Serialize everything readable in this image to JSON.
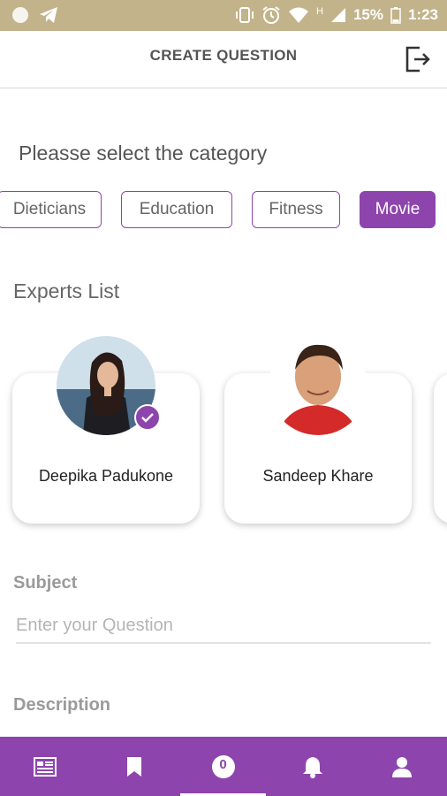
{
  "status_bar": {
    "battery_percent": "15%",
    "time": "1:23",
    "network_letter": "H"
  },
  "header": {
    "title": "CREATE QUESTION",
    "logout_icon": "logout-icon"
  },
  "prompt": "Pleasse select the category",
  "categories": [
    {
      "label": "Dieticians",
      "selected": false
    },
    {
      "label": "Education",
      "selected": false
    },
    {
      "label": "Fitness",
      "selected": false
    },
    {
      "label": "Movie",
      "selected": true
    }
  ],
  "experts": {
    "title": "Experts List",
    "items": [
      {
        "name": "Deepika Padukone",
        "selected": true
      },
      {
        "name": "Sandeep Khare",
        "selected": false
      }
    ]
  },
  "subject": {
    "label": "Subject",
    "placeholder": "Enter your Question",
    "value": ""
  },
  "description": {
    "label": "Description"
  },
  "bottom_nav": [
    {
      "icon": "feed-icon",
      "active": false
    },
    {
      "icon": "bookmark-icon",
      "active": false
    },
    {
      "icon": "question-badge-icon",
      "active": true,
      "badge": "0"
    },
    {
      "icon": "bell-icon",
      "active": false
    },
    {
      "icon": "profile-icon",
      "active": false
    }
  ],
  "colors": {
    "accent": "#8e44ad",
    "status_bar": "#c2b38a"
  }
}
